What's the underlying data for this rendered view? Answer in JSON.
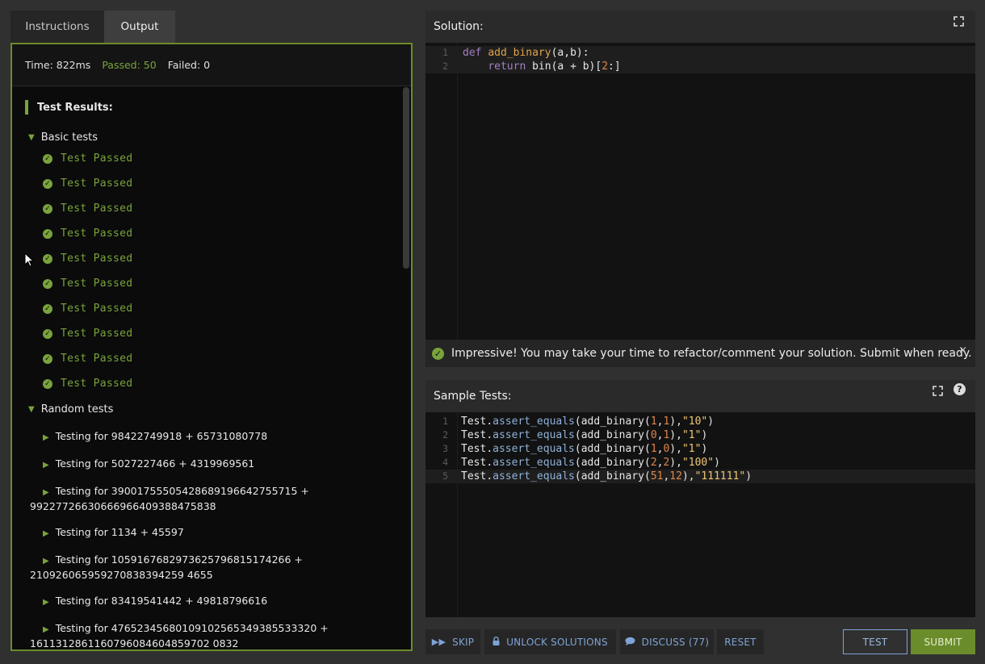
{
  "tabs": [
    "Instructions",
    "Output"
  ],
  "stats": {
    "time": "Time: 822ms",
    "passed": "Passed: 50",
    "failed": "Failed: 0"
  },
  "results": {
    "title": "Test Results:",
    "basic_group": "Basic tests",
    "passed_label": "Test Passed",
    "random_group": "Random tests",
    "random_tests": [
      [
        "Testing for 98422749918 + 65731080778"
      ],
      [
        "Testing for 5027227466 + 4319969561"
      ],
      [
        "Testing for 39001755505428689196642755715 +",
        "99227726630666966409388475838"
      ],
      [
        "Testing for 1134 + 45597"
      ],
      [
        "Testing for 105916768297362579681517 4266 +"
      ],
      [
        "Testing for 83419541442 + 49818796616"
      ],
      [
        "Testing for 476523456801091025653493855 33320 +"
      ]
    ],
    "random_display": [
      {
        "a": "Testing for 98422749918 + 65731080778",
        "b": ""
      },
      {
        "a": "Testing for 5027227466 + 4319969561",
        "b": ""
      },
      {
        "a": "Testing for 39001755505428689196642755715 +",
        "b": "99227726630666966409388475838"
      },
      {
        "a": "Testing for 1134 + 45597",
        "b": ""
      },
      {
        "a": "Testing for 1059167682973625796815174266 +",
        "b": "210926065959270838394259 4655"
      },
      {
        "a": "Testing for 83419541442 + 49818796616",
        "b": ""
      },
      {
        "a": "Testing for 47652345680109102565349385533320 +",
        "b": "1611312861160796084604859702 0832"
      }
    ]
  },
  "solution": {
    "title": "Solution:",
    "lines": [
      "1",
      "2"
    ]
  },
  "banner": {
    "text": "Impressive! You may take your time to refactor/comment your solution. Submit when ready.",
    "close": "×"
  },
  "sample_tests": {
    "title": "Sample Tests:",
    "lines": [
      "1",
      "2",
      "3",
      "4",
      "5"
    ]
  },
  "buttons": {
    "skip": "SKIP",
    "unlock": "UNLOCK SOLUTIONS",
    "discuss": "DISCUSS (77)",
    "reset": "RESET",
    "test": "TEST",
    "submit": "SUBMIT"
  },
  "icons": {
    "expand": "expand-icon",
    "help": "help-icon",
    "check": "check-circle-icon",
    "skip": "fast-forward-icon",
    "unlock": "lock-icon",
    "discuss": "chat-icon"
  },
  "colors": {
    "accent_green": "#79a33c",
    "link_blue": "#7fa3d6"
  }
}
